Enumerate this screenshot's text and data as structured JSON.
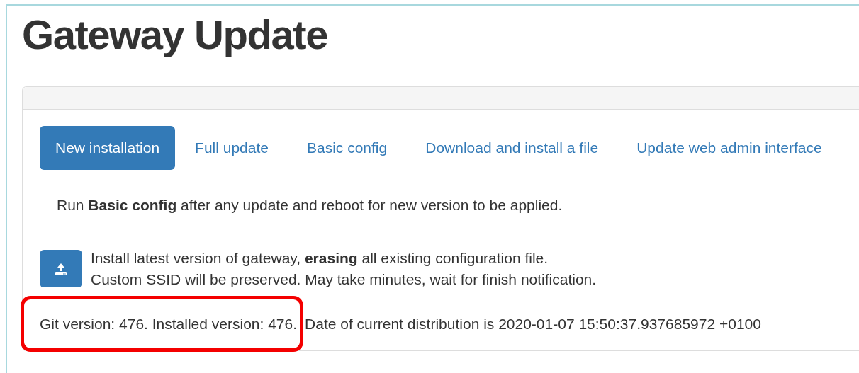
{
  "page": {
    "title": "Gateway Update"
  },
  "tabs": [
    {
      "label": "New installation",
      "selected": true
    },
    {
      "label": "Full update",
      "selected": false
    },
    {
      "label": "Basic config",
      "selected": false
    },
    {
      "label": "Download and install a file",
      "selected": false
    },
    {
      "label": "Update web admin interface",
      "selected": false
    }
  ],
  "note": "Run **Basic config** after any update and reboot for new version to be applied.",
  "action": {
    "description_lines": [
      "Install latest version of gateway, **erasing** all existing configuration file.",
      "Custom SSID will be preserved. May take minutes, wait for finish notification."
    ]
  },
  "version_info": {
    "highlighted": "Git version: 476. Installed version: 476.",
    "rest": "Date of current distribution is 2020-01-07 15:50:37.937685972 +0100"
  }
}
